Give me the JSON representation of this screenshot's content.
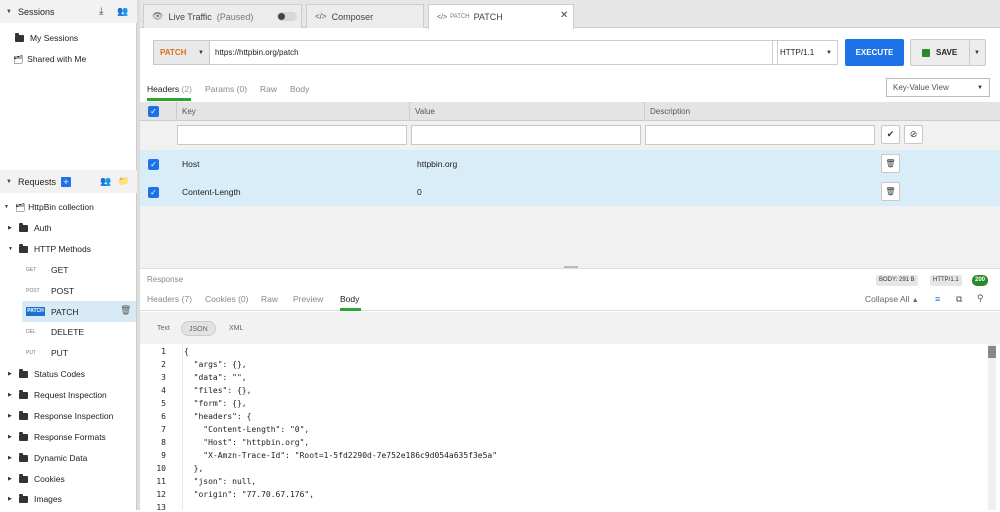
{
  "sidebar": {
    "sessions": {
      "title": "Sessions",
      "items": [
        "My Sessions",
        "Shared with Me"
      ]
    },
    "requests": {
      "title": "Requests"
    },
    "tree": {
      "collection": "HttpBin collection",
      "folders_top": [
        "Auth",
        "HTTP Methods"
      ],
      "methods": [
        {
          "tag": "GET",
          "label": "GET"
        },
        {
          "tag": "POST",
          "label": "POST"
        },
        {
          "tag": "PATCH",
          "label": "PATCH"
        },
        {
          "tag": "DEL",
          "label": "DELETE"
        },
        {
          "tag": "PUT",
          "label": "PUT"
        }
      ],
      "folders_bottom": [
        "Status Codes",
        "Request Inspection",
        "Response Inspection",
        "Response Formats",
        "Dynamic Data",
        "Cookies",
        "Images"
      ]
    }
  },
  "tabs": {
    "live": "Live Traffic",
    "live_status": "(Paused)",
    "composer": "Composer",
    "active_prefix": "PATCH",
    "active": "PATCH"
  },
  "request": {
    "method": "PATCH",
    "url": "https://httpbin.org/patch",
    "protocol": "HTTP/1.1",
    "execute": "EXECUTE",
    "save": "SAVE"
  },
  "req_tabs": {
    "headers": "Headers",
    "headers_count": "(2)",
    "params": "Params",
    "params_count": "(0)",
    "raw": "Raw",
    "body": "Body",
    "view": "Key-Value View"
  },
  "table": {
    "columns": {
      "key": "Key",
      "value": "Value",
      "description": "Description"
    },
    "rows": [
      {
        "key": "Host",
        "value": "httpbin.org"
      },
      {
        "key": "Content-Length",
        "value": "0"
      }
    ]
  },
  "response": {
    "label": "Response",
    "body_size": "BODY: 291 B",
    "protocol": "HTTP/1.1",
    "status": "200",
    "tabs": {
      "headers": "Headers",
      "headers_count": "(7)",
      "cookies": "Cookies",
      "cookies_count": "(0)",
      "raw": "Raw",
      "preview": "Preview",
      "body": "Body"
    },
    "collapse": "Collapse All",
    "formats": [
      "Text",
      "JSON",
      "XML"
    ],
    "lines": [
      "{",
      "  \"args\": {},",
      "  \"data\": \"\",",
      "  \"files\": {},",
      "  \"form\": {},",
      "  \"headers\": {",
      "    \"Content-Length\": \"0\",",
      "    \"Host\": \"httpbin.org\",",
      "    \"X-Amzn-Trace-Id\": \"Root=1-5fd2290d-7e752e186c9d054a635f3e5a\"",
      "  },",
      "  \"json\": null,",
      "  \"origin\": \"77.70.67.176\","
    ],
    "line_numbers": [
      "1",
      "2",
      "3",
      "4",
      "5",
      "6",
      "7",
      "8",
      "9",
      "10",
      "11",
      "12",
      "13"
    ]
  }
}
